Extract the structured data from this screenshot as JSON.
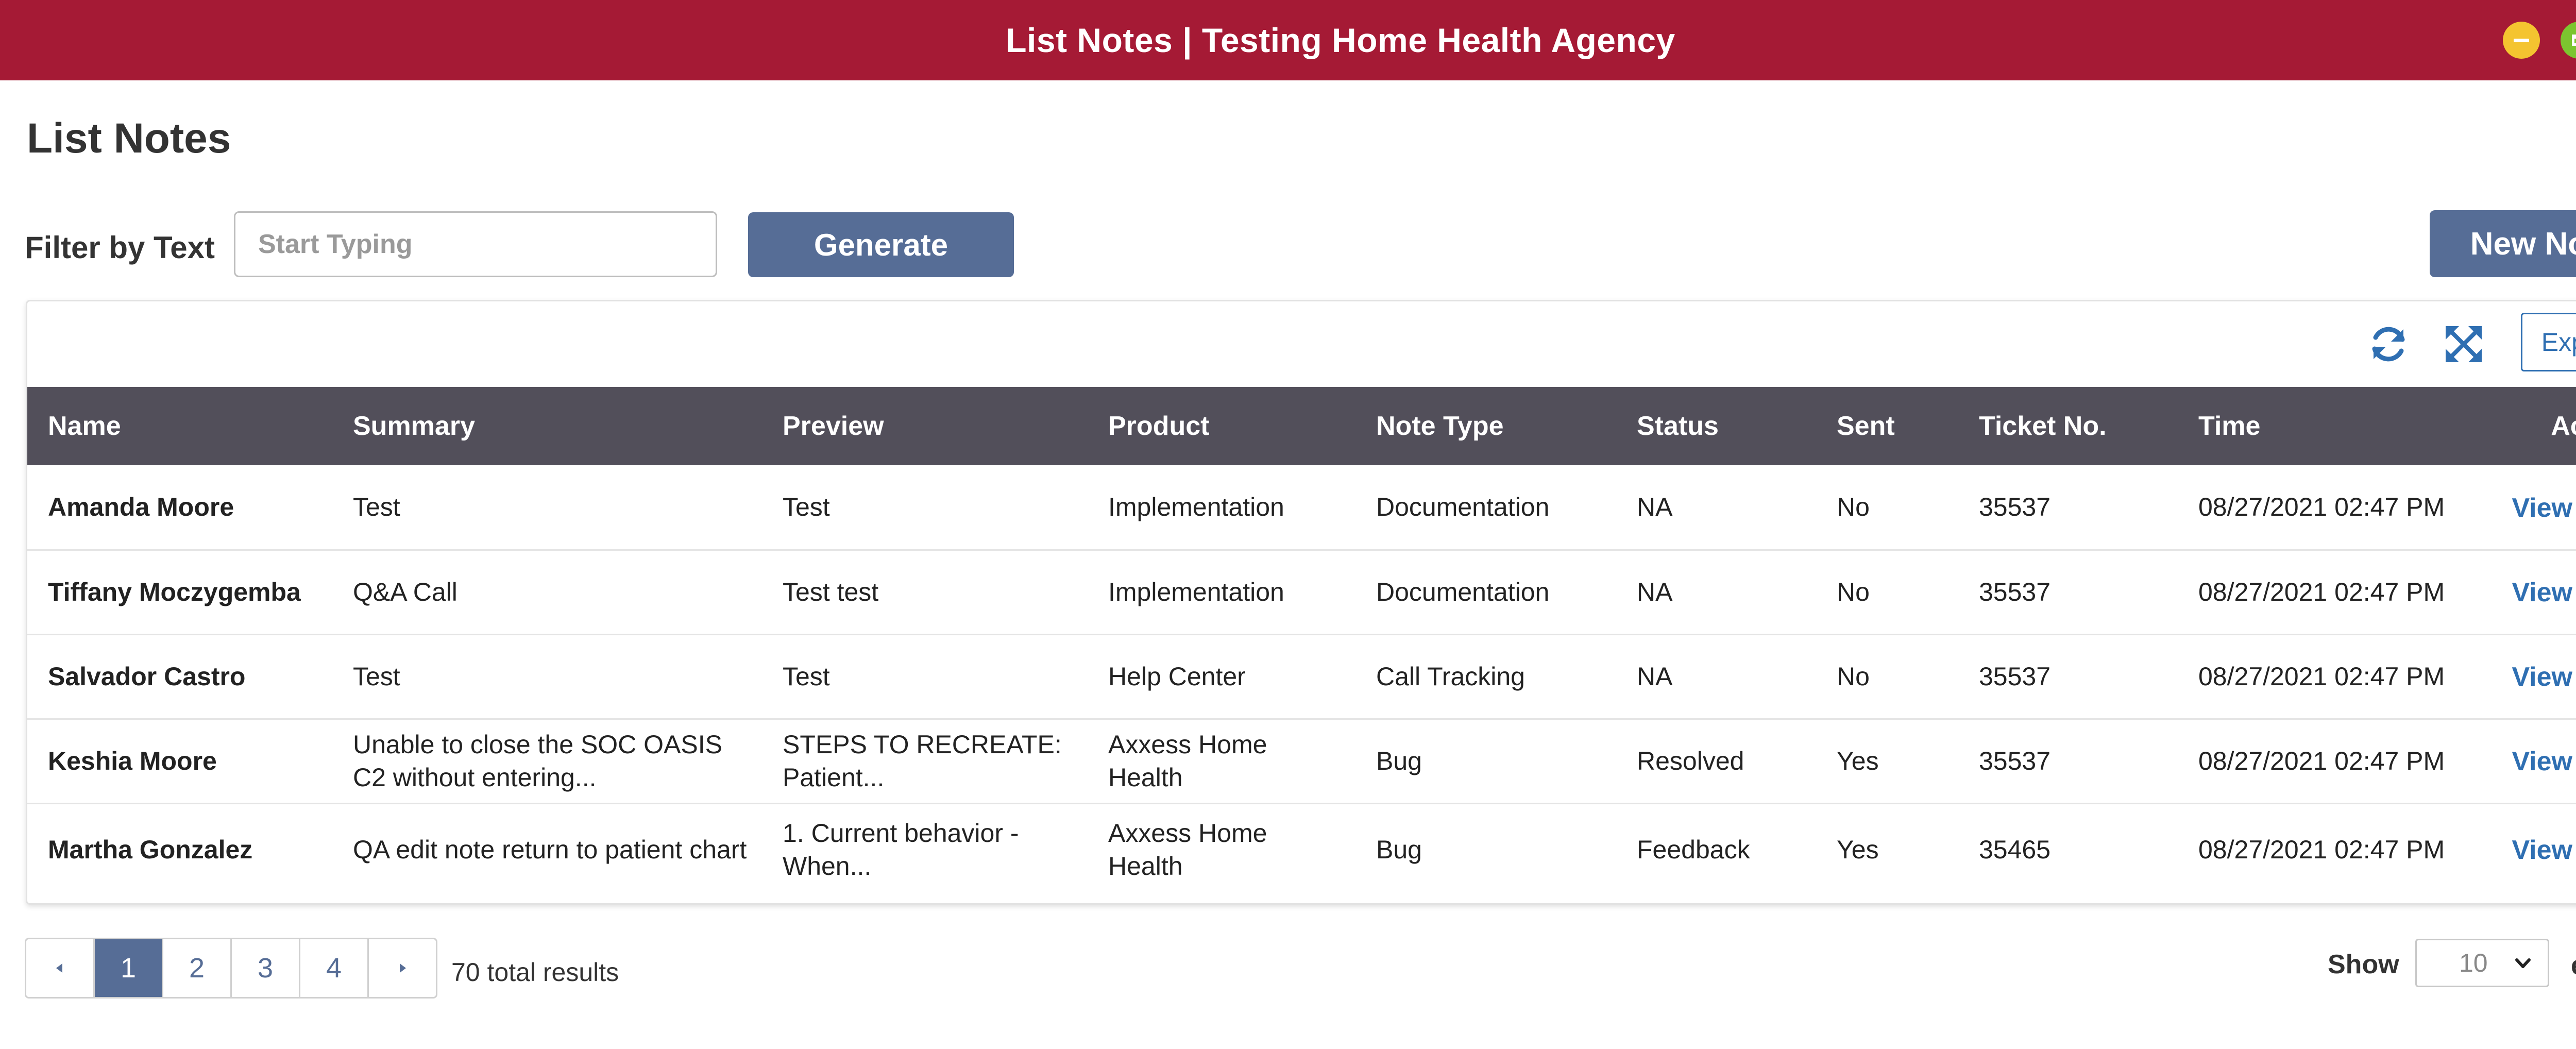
{
  "window": {
    "title": "List Notes | Testing Home Health Agency"
  },
  "page": {
    "title": "List Notes"
  },
  "filter": {
    "label": "Filter by Text",
    "placeholder": "Start Typing",
    "value": "",
    "generate_label": "Generate",
    "new_note_label": "New Note"
  },
  "toolbar": {
    "refresh_icon": "refresh-icon",
    "expand_icon": "expand-icon",
    "export_label": "Export"
  },
  "table": {
    "columns": [
      "Name",
      "Summary",
      "Preview",
      "Product",
      "Note Type",
      "Status",
      "Sent",
      "Ticket No.",
      "Time",
      "Action"
    ],
    "view_label": "View",
    "rows": [
      {
        "name": "Amanda Moore",
        "summary": "Test",
        "preview": "Test",
        "product": "Implementation",
        "note_type": "Documentation",
        "status": "NA",
        "sent": "No",
        "ticket": "35537",
        "time": "08/27/2021 02:47 PM"
      },
      {
        "name": "Tiffany Moczygemba",
        "summary": "Q&A Call",
        "preview": "Test test",
        "product": "Implementation",
        "note_type": "Documentation",
        "status": "NA",
        "sent": "No",
        "ticket": "35537",
        "time": "08/27/2021 02:47 PM"
      },
      {
        "name": "Salvador Castro",
        "summary": "Test",
        "preview": "Test",
        "product": "Help Center",
        "note_type": "Call Tracking",
        "status": "NA",
        "sent": "No",
        "ticket": "35537",
        "time": "08/27/2021 02:47 PM"
      },
      {
        "name": "Keshia Moore",
        "summary": "Unable to close the SOC OASIS C2 without entering...",
        "preview": "STEPS TO RECREATE: Patient...",
        "product": "Axxess Home Health",
        "note_type": "Bug",
        "status": "Resolved",
        "sent": "Yes",
        "ticket": "35537",
        "time": "08/27/2021 02:47 PM"
      },
      {
        "name": "Martha Gonzalez",
        "summary": "QA edit note return to patient chart",
        "preview": "1. Current behavior - When...",
        "product": "Axxess Home Health",
        "note_type": "Bug",
        "status": "Feedback",
        "sent": "Yes",
        "ticket": "35465",
        "time": "08/27/2021 02:47 PM"
      }
    ]
  },
  "pagination": {
    "pages": [
      "1",
      "2",
      "3",
      "4"
    ],
    "current": "1",
    "total_text": "70 total results",
    "show_label": "Show",
    "entries_value": "10",
    "entries_label": "entries"
  },
  "colors": {
    "titlebar": "#a51a35",
    "primary_button": "#566d96",
    "table_header": "#524f5a",
    "link": "#2f6fb2",
    "delete": "#d9342b"
  }
}
